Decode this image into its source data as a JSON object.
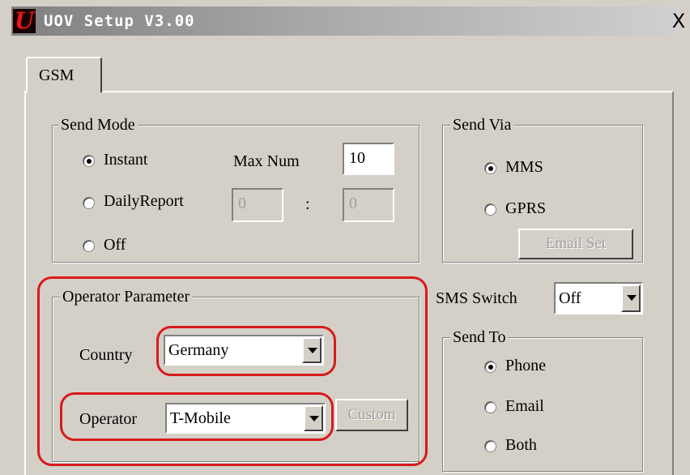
{
  "window": {
    "title": "UOV Setup V3.00",
    "close_label": "X"
  },
  "tabs": [
    {
      "label": "GSM"
    }
  ],
  "send_mode": {
    "legend": "Send Mode",
    "options": {
      "instant": "Instant",
      "daily_report": "DailyReport",
      "off": "Off"
    },
    "selected": "instant",
    "max_num_label": "Max Num",
    "max_num_value": "10",
    "daily_hour_value": "0",
    "daily_separator": ":",
    "daily_minute_value": "0"
  },
  "send_via": {
    "legend": "Send Via",
    "options": {
      "mms": "MMS",
      "gprs": "GPRS"
    },
    "selected": "mms",
    "email_set_label": "Email Set"
  },
  "operator_parameter": {
    "legend": "Operator Parameter",
    "country_label": "Country",
    "country_value": "Germany",
    "operator_label": "Operator",
    "operator_value": "T-Mobile",
    "custom_label": "Custom"
  },
  "sms_switch": {
    "label": "SMS Switch",
    "value": "Off"
  },
  "send_to": {
    "legend": "Send To",
    "options": {
      "phone": "Phone",
      "email": "Email",
      "both": "Both"
    },
    "selected": "phone"
  },
  "colors": {
    "annotation_red": "#d81a1a",
    "face": "#d4d0c8",
    "app_icon_red": "#e01818"
  },
  "icons": {
    "app": "app-logo-icon",
    "close": "close-icon",
    "dropdown": "dropdown-arrow-icon"
  }
}
